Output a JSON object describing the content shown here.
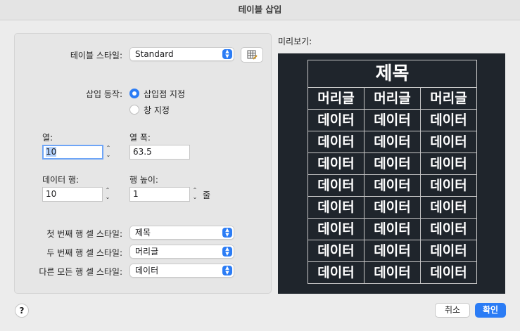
{
  "window": {
    "title": "테이블 삽입"
  },
  "style_row": {
    "label": "테이블 스타일:",
    "value": "Standard"
  },
  "insert_mode": {
    "label": "삽입 동작:",
    "options": [
      "삽입점 지정",
      "창 지정"
    ],
    "selected": "삽입점 지정"
  },
  "columns": {
    "label": "열:",
    "value": "10"
  },
  "column_width": {
    "label": "열 폭:",
    "value": "63.5"
  },
  "data_rows": {
    "label": "데이터 행:",
    "value": "10"
  },
  "row_height": {
    "label": "행 높이:",
    "value": "1",
    "unit": "줄"
  },
  "cell_styles": [
    {
      "label": "첫 번째 행 셀 스타일:",
      "value": "제목"
    },
    {
      "label": "두 번째 행 셀 스타일:",
      "value": "머리글"
    },
    {
      "label": "다른 모든 행 셀 스타일:",
      "value": "데이터"
    }
  ],
  "preview": {
    "label": "미리보기:",
    "title": "제목",
    "header_cells": [
      "머리글",
      "머리글",
      "머리글"
    ],
    "data_cell": "데이터",
    "data_row_count": 8
  },
  "buttons": {
    "help": "?",
    "cancel": "취소",
    "ok": "확인"
  },
  "colors": {
    "accent": "#2b7cf5",
    "preview_bg": "#1f252c"
  }
}
